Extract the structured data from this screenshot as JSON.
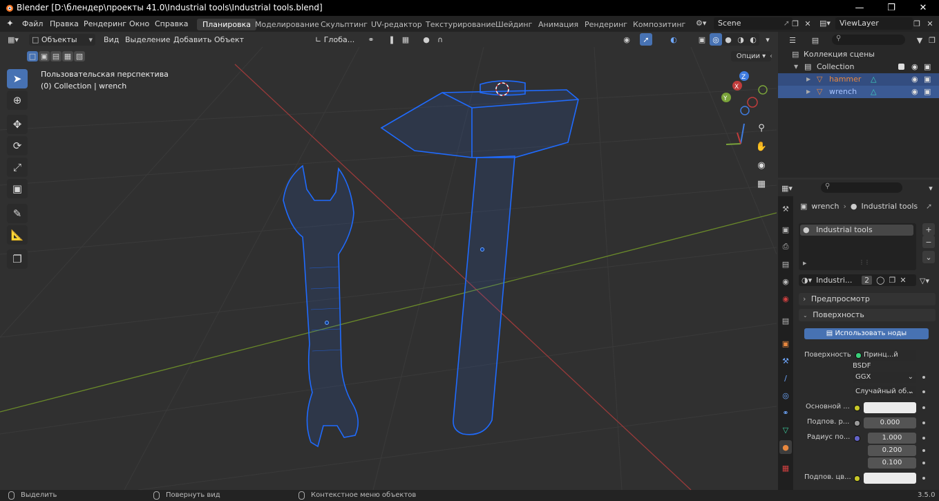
{
  "window": {
    "title": "Blender [D:\\блендер\\проекты 41.0\\Industrial tools\\Industrial tools.blend]",
    "minimize_icon": "minimize-icon",
    "maximize_icon": "maximize-icon",
    "close_icon": "close-icon"
  },
  "menubar": {
    "menus": [
      "Файл",
      "Правка",
      "Рендеринг",
      "Окно",
      "Справка"
    ],
    "workspaces": [
      "Планировка",
      "Моделирование",
      "Скульптинг",
      "UV-редактор",
      "Текстурирование",
      "Шейдинг",
      "Анимация",
      "Рендеринг",
      "Композитинг"
    ],
    "active_workspace": "Планировка",
    "scene": "Scene",
    "view_layer": "ViewLayer"
  },
  "viewport_header": {
    "mode": "Объекты",
    "menus": [
      "Вид",
      "Выделение",
      "Добавить",
      "Объект"
    ],
    "transform_orientation": "Глоба...",
    "options_label": "Опции"
  },
  "viewport": {
    "view_name": "Пользовательская перспектива",
    "context": "(0) Collection | wrench",
    "gizmo": {
      "x": "X",
      "y": "Y",
      "z": "Z"
    },
    "colors": {
      "background": "#303030",
      "grid": "#3a3a3a",
      "x_axis": "#9a3a3a",
      "y_axis": "#6a8a2a",
      "wire": "#1f6bff"
    }
  },
  "outliner": {
    "root": "Коллекция сцены",
    "collection": "Collection",
    "objects": [
      {
        "name": "hammer",
        "color": "#e8883f"
      },
      {
        "name": "wrench",
        "color": "#a9c4ff"
      }
    ]
  },
  "properties": {
    "breadcrumb_object": "wrench",
    "breadcrumb_material": "Industrial tools",
    "material_slot": "Industrial tools",
    "material_name": "Industri...",
    "user_count": "2",
    "panel_preview": "Предпросмотр",
    "panel_surface": "Поверхность",
    "use_nodes": "Использовать ноды",
    "surface_label": "Поверхность",
    "surface_value": "Принц...й BSDF",
    "distribution": "GGX",
    "subsurface_method": "Случайный об...",
    "base_color_label": "Основной ...",
    "subsurface_label": "Подпов. р...",
    "subsurface_value": "0.000",
    "radius_label": "Радиус по...",
    "radius_values": [
      "1.000",
      "0.200",
      "0.100"
    ],
    "subsurface_color_label": "Подпов. цв..."
  },
  "statusbar": {
    "select": "Выделить",
    "rotate": "Повернуть вид",
    "context_menu": "Контекстное меню объектов",
    "version": "3.5.0"
  }
}
